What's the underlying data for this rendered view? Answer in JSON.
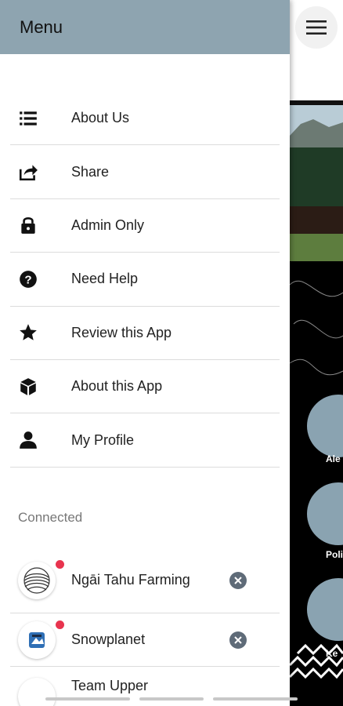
{
  "drawer": {
    "title": "Menu",
    "items": [
      {
        "label": "About Us",
        "icon": "list-icon"
      },
      {
        "label": "Share",
        "icon": "share-icon"
      },
      {
        "label": "Admin Only",
        "icon": "lock-icon"
      },
      {
        "label": "Need Help",
        "icon": "help-icon"
      },
      {
        "label": "Review this App",
        "icon": "star-icon"
      },
      {
        "label": "About this App",
        "icon": "cube-icon"
      },
      {
        "label": "My Profile",
        "icon": "person-icon"
      }
    ],
    "connected_header": "Connected",
    "connected": [
      {
        "label": "Ngāi Tahu Farming",
        "unread": true
      },
      {
        "label": "Snowplanet",
        "unread": true
      },
      {
        "label": "Team Upper",
        "unread": false
      }
    ]
  },
  "background": {
    "tiles": [
      {
        "label": "Ale",
        "icon": "megaphone-icon"
      },
      {
        "label": "Polic",
        "icon": "layers-icon"
      },
      {
        "label": "Ke",
        "icon": "trash-icon"
      }
    ]
  },
  "colors": {
    "drawer_header": "#8ea4b0",
    "tile": "#8aa3b1",
    "unread_dot": "#e8344e"
  }
}
